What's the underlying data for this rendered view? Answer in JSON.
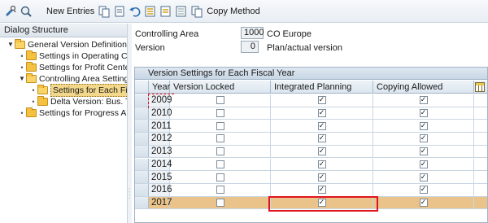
{
  "toolbar": {
    "new_entries_label": "New Entries",
    "copy_method_label": "Copy Method"
  },
  "left": {
    "header": "Dialog Structure",
    "items": [
      {
        "label": "General Version Definition"
      },
      {
        "label": "Settings in Operating Concern"
      },
      {
        "label": "Settings for Profit Center Accounting"
      },
      {
        "label": "Controlling Area Settings"
      },
      {
        "label": "Settings for Each Fiscal Year"
      },
      {
        "label": "Delta Version: Bus. Transactions"
      },
      {
        "label": "Settings for Progress Analysis"
      }
    ]
  },
  "header_fields": {
    "controlling_area_label": "Controlling Area",
    "controlling_area_value": "1000",
    "controlling_area_desc": "CO Europe",
    "version_label": "Version",
    "version_value": "0",
    "version_desc": "Plan/actual version"
  },
  "table": {
    "title": "Version Settings for Each Fiscal Year",
    "columns": [
      "Year",
      "Version Locked",
      "Integrated Planning",
      "Copying Allowed"
    ],
    "rows": [
      {
        "year": "2009",
        "locked": false,
        "integrated": true,
        "copying": true
      },
      {
        "year": "2010",
        "locked": false,
        "integrated": true,
        "copying": true
      },
      {
        "year": "2011",
        "locked": false,
        "integrated": true,
        "copying": true
      },
      {
        "year": "2012",
        "locked": false,
        "integrated": true,
        "copying": true
      },
      {
        "year": "2013",
        "locked": false,
        "integrated": true,
        "copying": true
      },
      {
        "year": "2014",
        "locked": false,
        "integrated": true,
        "copying": true
      },
      {
        "year": "2015",
        "locked": false,
        "integrated": true,
        "copying": true
      },
      {
        "year": "2016",
        "locked": false,
        "integrated": true,
        "copying": true
      },
      {
        "year": "2017",
        "locked": false,
        "integrated": true,
        "copying": true
      }
    ],
    "highlighted_row": "2017"
  },
  "colors": {
    "highlight_row": "#e9c38a",
    "focus_border": "#e0141e",
    "folder": "#f4c240"
  }
}
